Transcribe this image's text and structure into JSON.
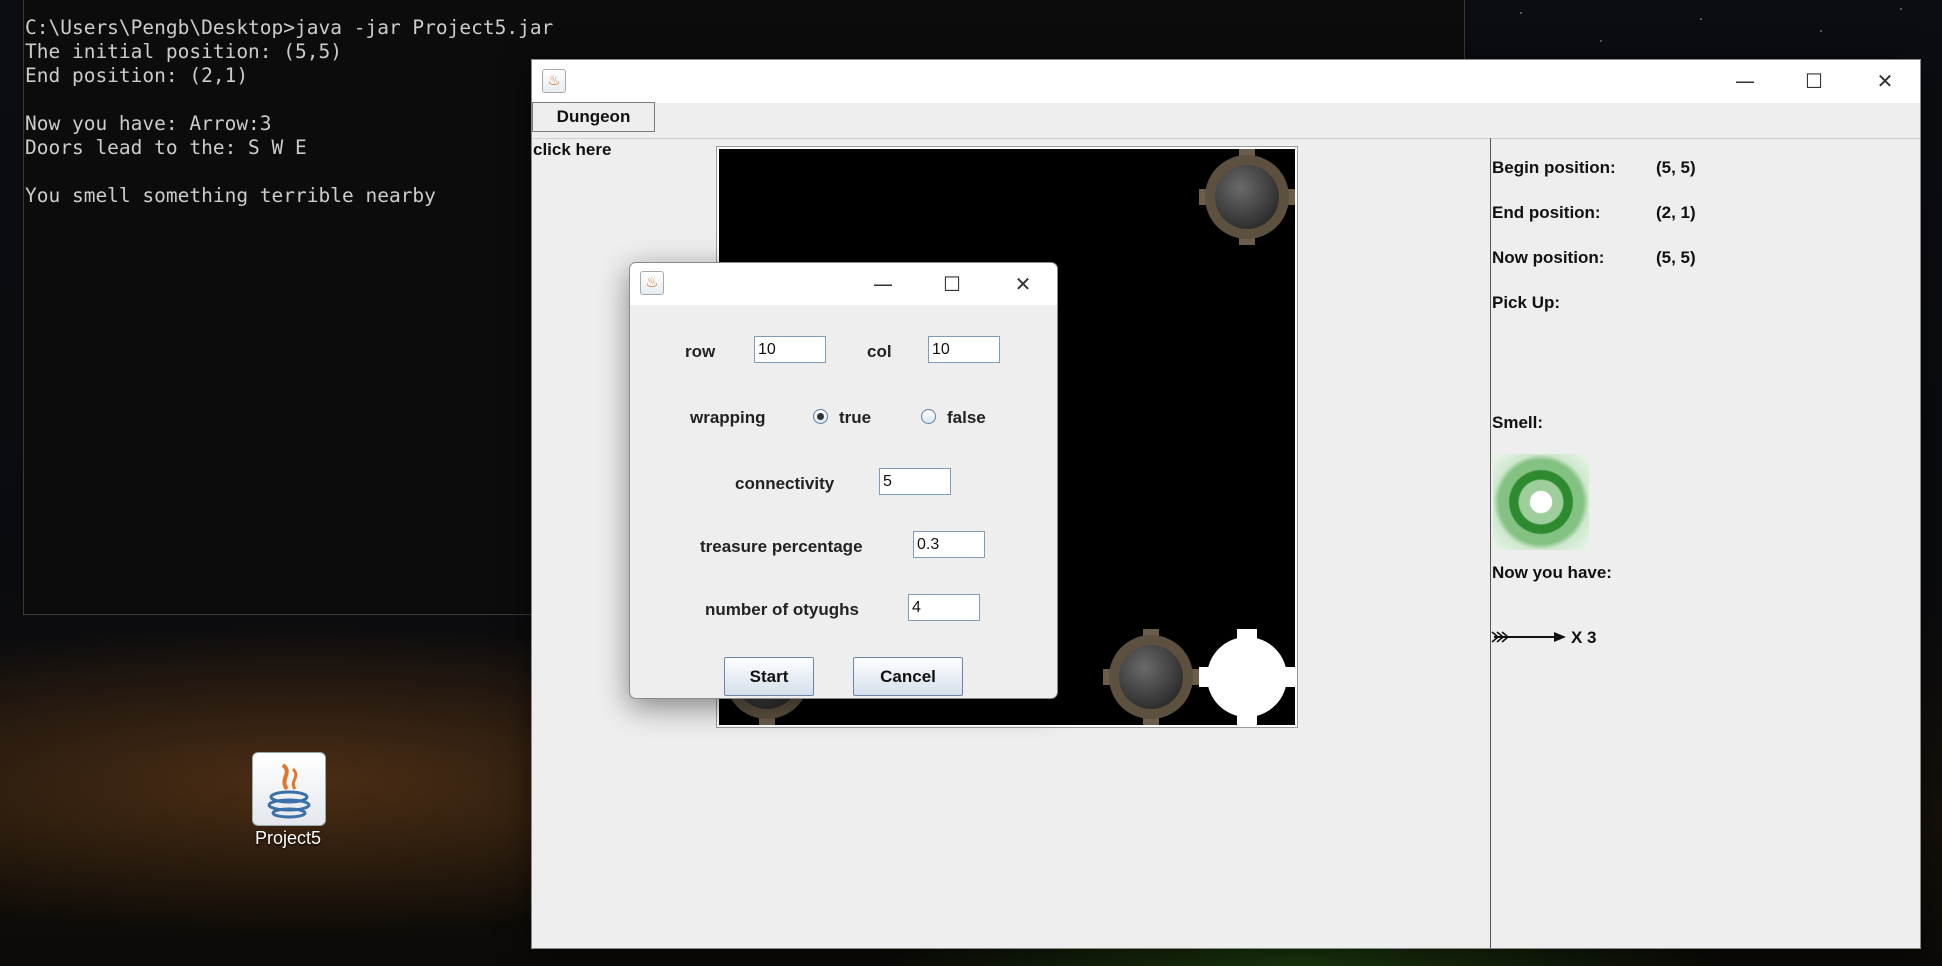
{
  "console": {
    "lines": [
      "C:\\Users\\Pengb\\Desktop>java -jar Project5.jar",
      "The initial position: (5,5)",
      "End position: (2,1)",
      "",
      "Now you have: Arrow:3",
      "Doors lead to the: S W E",
      "",
      "You smell something terrible nearby"
    ]
  },
  "main_window": {
    "controls": {
      "minimize": "—",
      "maximize": "☐",
      "close": "✕"
    },
    "menu": {
      "dungeon_label": "Dungeon"
    },
    "click_here_label": "click here"
  },
  "info_panel": {
    "begin_label": "Begin position:",
    "begin_value": "(5, 5)",
    "end_label": "End position:",
    "end_value": "(2, 1)",
    "now_label": "Now position:",
    "now_value": "(5, 5)",
    "pickup_label": "Pick Up:",
    "smell_label": "Smell:",
    "have_label": "Now you have:",
    "arrow_count": "X 3"
  },
  "dialog": {
    "controls": {
      "minimize": "—",
      "maximize": "☐",
      "close": "✕"
    },
    "row_label": "row",
    "row_value": "10",
    "col_label": "col",
    "col_value": "10",
    "wrapping_label": "wrapping",
    "wrapping_true_label": "true",
    "wrapping_false_label": "false",
    "wrapping_selected": "true",
    "connectivity_label": "connectivity",
    "connectivity_value": "5",
    "treasure_label": "treasure percentage",
    "treasure_value": "0.3",
    "otyughs_label": "number of otyughs",
    "otyughs_value": "4",
    "start_label": "Start",
    "cancel_label": "Cancel"
  },
  "desktop": {
    "icon_label": "Project5"
  },
  "colors": {
    "console_bg": "#0c0c0c",
    "console_text": "#cccccc",
    "window_bg": "#eeeeee",
    "maze_bg": "#000000"
  },
  "icons": {
    "app": "java-icon",
    "smell": "smell-icon",
    "arrow": "arrow-icon"
  }
}
